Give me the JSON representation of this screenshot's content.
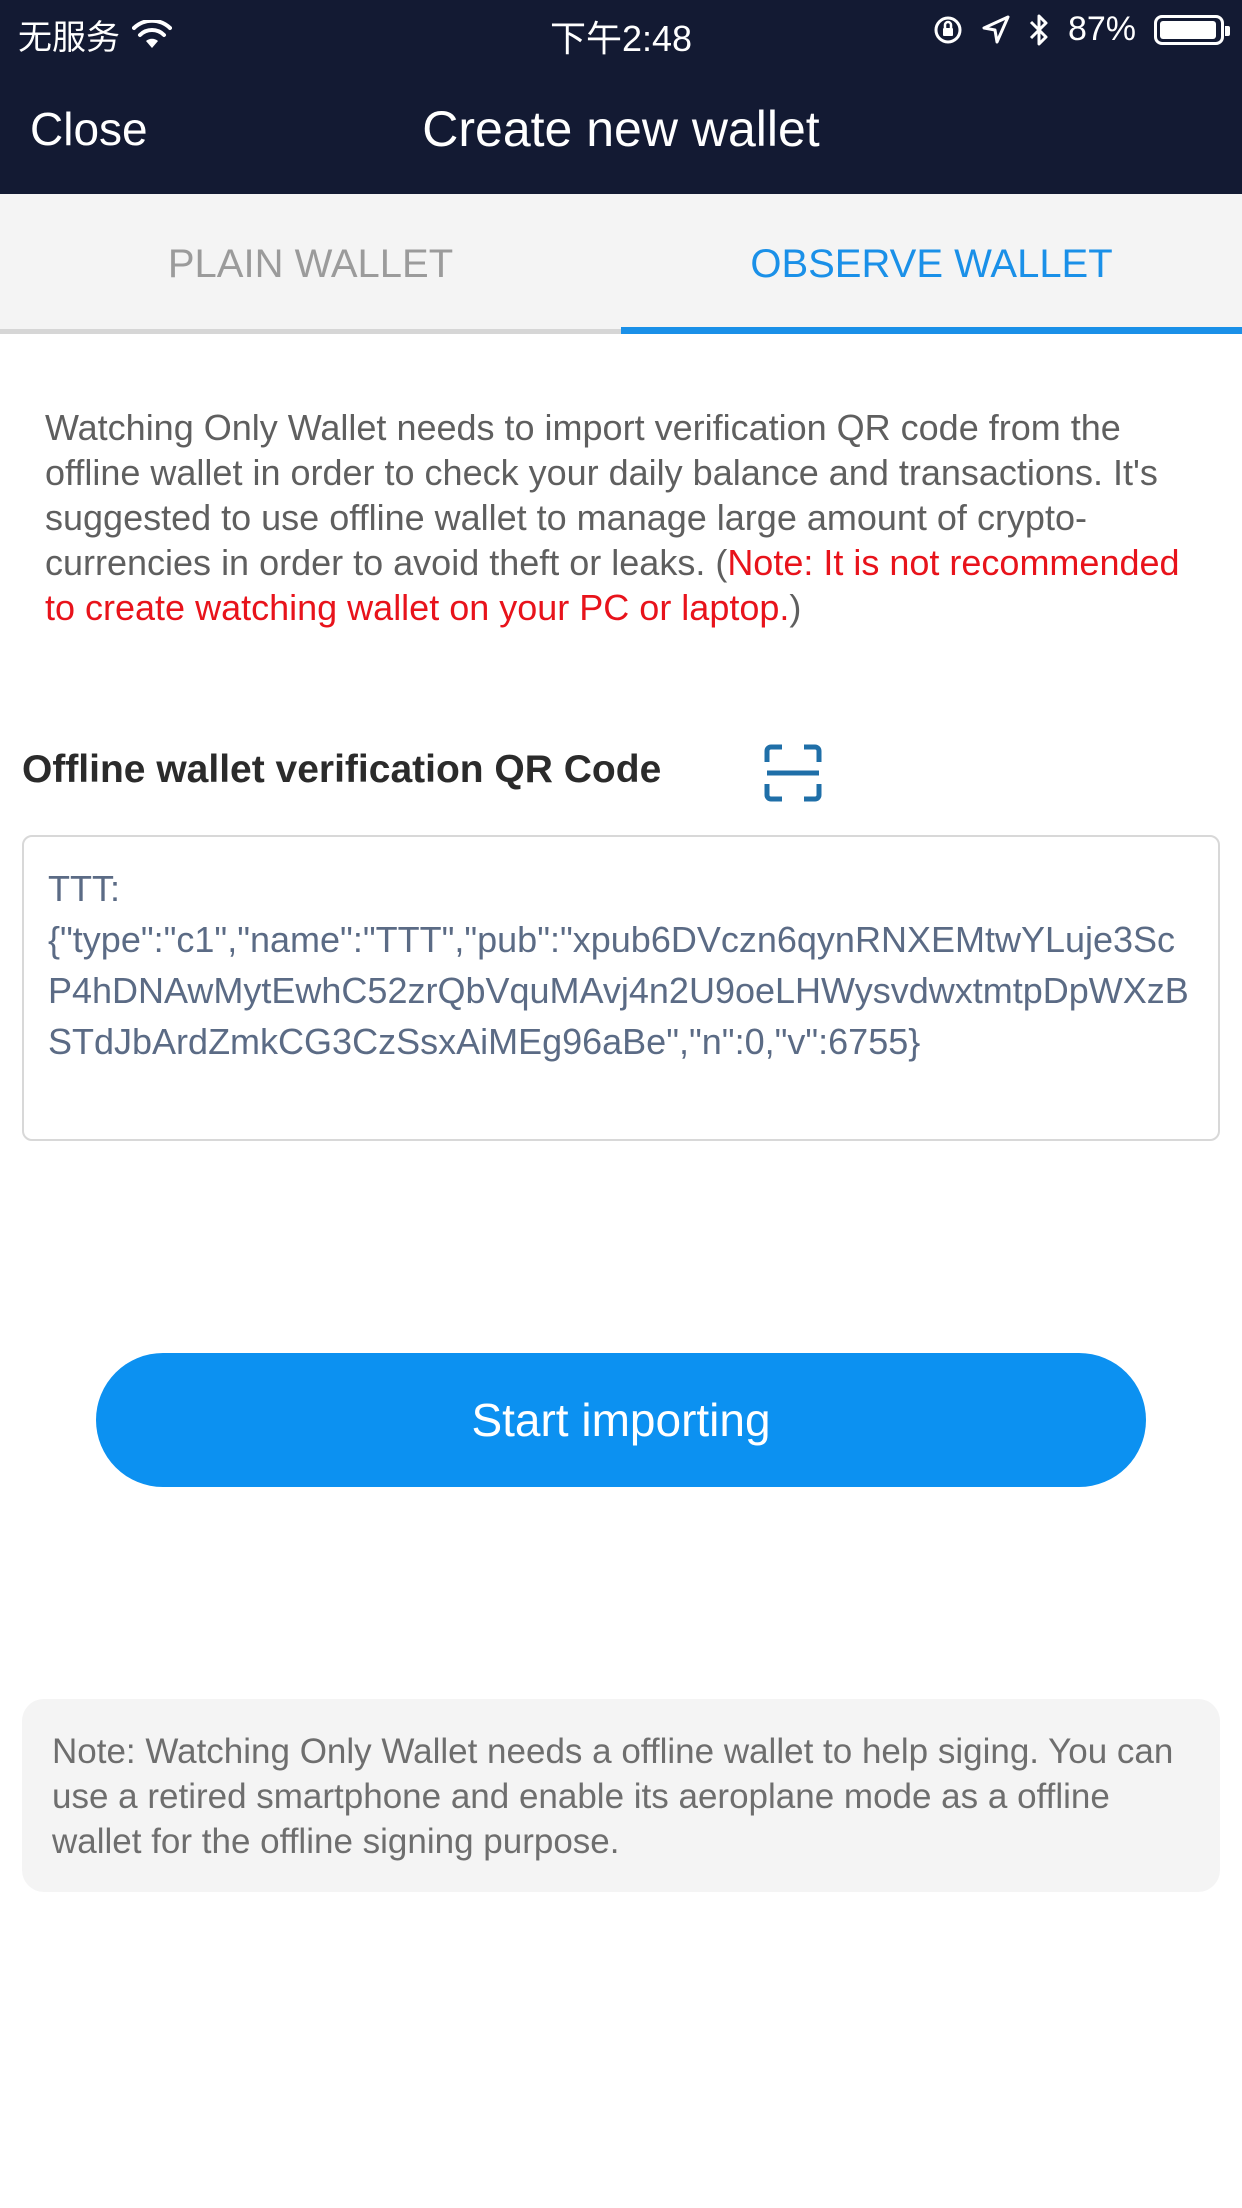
{
  "status_bar": {
    "carrier": "无服务",
    "time": "下午2:48",
    "battery": "87%",
    "battery_level": 0.87
  },
  "nav": {
    "close_label": "Close",
    "title": "Create new wallet"
  },
  "tabs": [
    {
      "label": "PLAIN WALLET",
      "active": false
    },
    {
      "label": "OBSERVE WALLET",
      "active": true
    }
  ],
  "description": {
    "text": "Watching Only Wallet needs to import verification QR code from the offline wallet in order to check your daily balance and transactions. It's suggested to use offline wallet to manage large amount of crypto-currencies in order to avoid theft or leaks. (",
    "warning": "Note: It is not recommended to create watching wallet on your PC or laptop.",
    "closing": ")"
  },
  "qr": {
    "label": "Offline wallet verification QR Code",
    "value": "TTT:\n{\"type\":\"c1\",\"name\":\"TTT\",\"pub\":\"xpub6DVczn6qynRNXEMtwYLuje3ScP4hDNAwMytEwhC52zrQbVquMAvj4n2U9oeLHWysvdwxtmtpDpWXzBSTdJbArdZmkCG3CzSsxAiMEg96aBe\",\"n\":0,\"v\":6755}"
  },
  "import_button_label": "Start importing",
  "note": "Note: Watching Only Wallet needs a offline wallet to help siging. You can use a retired smartphone and enable its aeroplane mode as a offline wallet for the offline signing purpose.",
  "colors": {
    "header_bg": "#131a33",
    "accent": "#1a90e8",
    "button": "#0c91f1",
    "warning": "#e8131b"
  }
}
